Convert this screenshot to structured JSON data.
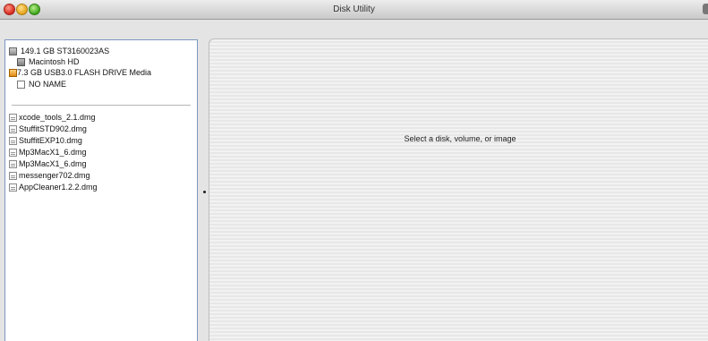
{
  "window": {
    "title": "Disk Utility"
  },
  "sidebar": {
    "disks": [
      {
        "label": "149.1 GB ST3160023AS",
        "icon": "hard-disk-icon",
        "level": 0
      },
      {
        "label": "Macintosh HD",
        "icon": "volume-icon",
        "level": 1
      },
      {
        "label": "7.3 GB USB3.0 FLASH DRIVE Media",
        "icon": "usb-drive-icon",
        "level": 0
      },
      {
        "label": "NO NAME",
        "icon": "empty-volume-icon",
        "level": 1
      }
    ],
    "images": [
      {
        "label": "xcode_tools_2.1.dmg",
        "icon": "disk-image-icon"
      },
      {
        "label": "StuffitSTD902.dmg",
        "icon": "disk-image-icon"
      },
      {
        "label": "StuffitEXP10.dmg",
        "icon": "disk-image-icon"
      },
      {
        "label": "Mp3MacX1_6.dmg",
        "icon": "disk-image-icon"
      },
      {
        "label": "Mp3MacX1_6.dmg",
        "icon": "disk-image-icon"
      },
      {
        "label": "messenger702.dmg",
        "icon": "disk-image-icon"
      },
      {
        "label": "AppCleaner1.2.2.dmg",
        "icon": "disk-image-icon"
      }
    ]
  },
  "main": {
    "hint": "Select a disk, volume, or image"
  },
  "colors": {
    "sidebar_border": "#7d97c4",
    "window_bg": "#e4e4e4",
    "content_bg": "#f2f2f2"
  }
}
